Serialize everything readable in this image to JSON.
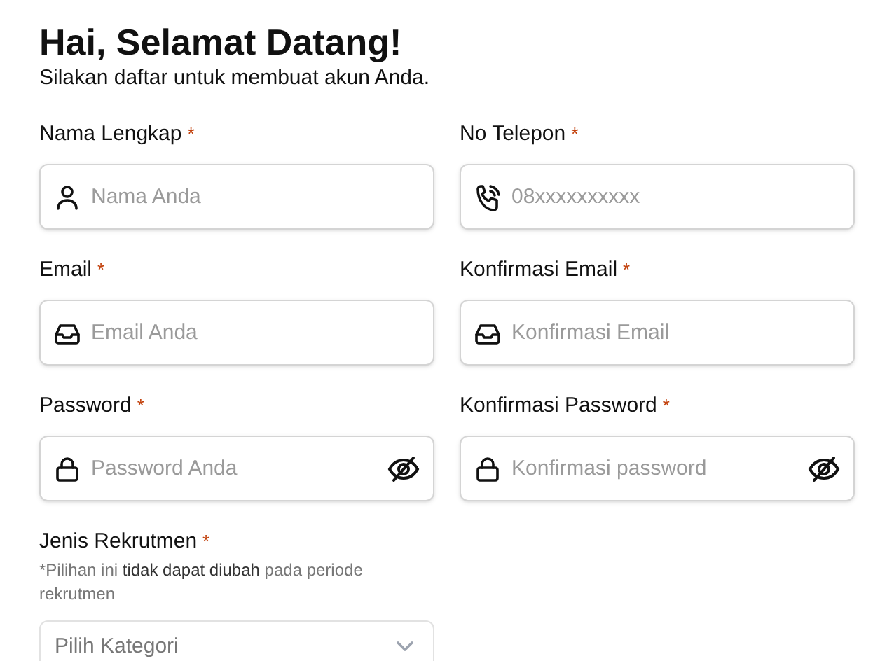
{
  "title": "Hai, Selamat Datang!",
  "subtitle": "Silakan daftar untuk membuat akun Anda.",
  "fields": [
    {
      "kind": "name",
      "label": "Nama Lengkap",
      "required_mark": "*",
      "placeholder": "Nama Anda"
    },
    {
      "kind": "phone",
      "label": "No Telepon",
      "required_mark": "*",
      "placeholder": "08xxxxxxxxxx"
    },
    {
      "kind": "email",
      "label": "Email",
      "required_mark": "*",
      "placeholder": "Email Anda"
    },
    {
      "kind": "email",
      "label": "Konfirmasi Email",
      "required_mark": "*",
      "placeholder": "Konfirmasi Email"
    },
    {
      "kind": "password",
      "label": "Password",
      "required_mark": "*",
      "placeholder": "Password Anda"
    },
    {
      "kind": "password",
      "label": "Konfirmasi Password",
      "required_mark": "*",
      "placeholder": "Konfirmasi password"
    },
    {
      "kind": "select",
      "label": "Jenis Rekrutmen",
      "required_mark": "*",
      "hint": "*Pilihan ini **tidak dapat diubah** pada periode rekrutmen",
      "placeholder": "Pilih Kategori"
    }
  ]
}
